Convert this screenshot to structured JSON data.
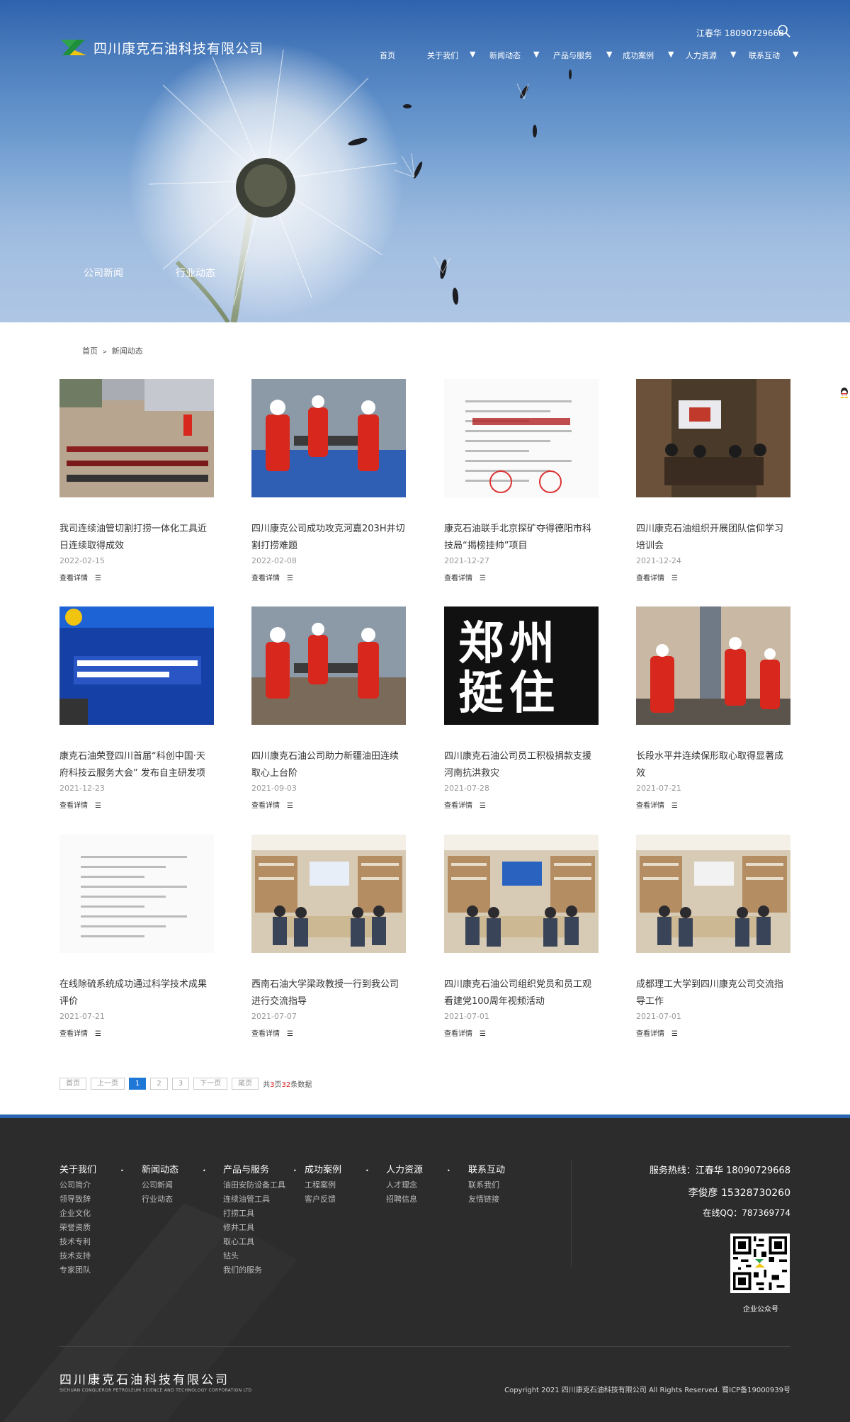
{
  "header": {
    "company_name": "四川康克石油科技有限公司",
    "contact": "江春华 18090729668",
    "nav": [
      "首页",
      "关于我们",
      "新闻动态",
      "产品与服务",
      "成功案例",
      "人力资源",
      "联系互动"
    ],
    "nav_has_dropdown": [
      false,
      true,
      true,
      true,
      true,
      true,
      true
    ]
  },
  "banner": {
    "subnav": [
      "公司新闻",
      "行业动态"
    ]
  },
  "breadcrumb": {
    "home": "首页",
    "separator": ">",
    "current": "新闻动态"
  },
  "news": {
    "more_label": "查看详情",
    "items": [
      {
        "title": "我司连续油管切割打捞一体化工具近日连续取得成效",
        "date": "2022-02-15",
        "img": "site"
      },
      {
        "title": "四川康克公司成功攻克河嘉203H井切割打捞难题",
        "date": "2022-02-08",
        "img": "workers"
      },
      {
        "title": "康克石油联手北京探矿夺得德阳市科技局“揭榜挂帅”项目",
        "date": "2021-12-27",
        "img": "doc-red"
      },
      {
        "title": "四川康克石油组织开展团队信仰学习培训会",
        "date": "2021-12-24",
        "img": "meeting"
      },
      {
        "title": "康克石油荣登四川首届“科创中国·天府科技云服务大会” 发布自主研发项",
        "date": "2021-12-23",
        "img": "screen"
      },
      {
        "title": "四川康克石油公司助力新疆油田连续取心上台阶",
        "date": "2021-09-03",
        "img": "workers2"
      },
      {
        "title": "四川康克石油公司员工积极捐款支援河南抗洪救灾",
        "date": "2021-07-28",
        "img": "zhengzhou"
      },
      {
        "title": "长段水平井连续保形取心取得显著成效",
        "date": "2021-07-21",
        "img": "rig"
      },
      {
        "title": "在线除硫系统成功通过科学技术成果评价",
        "date": "2021-07-21",
        "img": "doc"
      },
      {
        "title": "西南石油大学梁政教授一行到我公司进行交流指导",
        "date": "2021-07-07",
        "img": "conf"
      },
      {
        "title": "四川康克石油公司组织党员和员工观看建党100周年视频活动",
        "date": "2021-07-01",
        "img": "conf2"
      },
      {
        "title": "成都理工大学到四川康克公司交流指导工作",
        "date": "2021-07-01",
        "img": "conf3"
      }
    ],
    "zhengzhou_text": "郑州挺住"
  },
  "pagination": {
    "first": "首页",
    "prev": "上一页",
    "pages": [
      "1",
      "2",
      "3"
    ],
    "current": "1",
    "next": "下一页",
    "last": "尾页",
    "info_prefix": "共",
    "total_pages": "3",
    "info_mid": "页",
    "total_items": "32",
    "info_suffix": "条数据"
  },
  "footer": {
    "columns": [
      {
        "title": "关于我们",
        "links": [
          "公司简介",
          "领导致辞",
          "企业文化",
          "荣誉资质",
          "技术专利",
          "技术支持",
          "专家团队"
        ]
      },
      {
        "title": "新闻动态",
        "links": [
          "公司新闻",
          "行业动态"
        ]
      },
      {
        "title": "产品与服务",
        "links": [
          "油田安防设备工具",
          "连续油管工具",
          "打捞工具",
          "修井工具",
          "取心工具",
          "钻头",
          "我们的服务"
        ]
      },
      {
        "title": "成功案例",
        "links": [
          "工程案例",
          "客户反馈"
        ]
      },
      {
        "title": "人力资源",
        "links": [
          "人才理念",
          "招聘信息"
        ]
      },
      {
        "title": "联系互动",
        "links": [
          "联系我们",
          "友情链接"
        ]
      }
    ],
    "hotline": "服务热线：江春华 18090729668",
    "contact2": "李俊彦 15328730260",
    "qq": "在线QQ：787369774",
    "qr_caption": "企业公众号",
    "company_name": "四川康克石油科技有限公司",
    "company_name_en": "SICHUAN CONQUEROR PETROLEUM SCIENCE AND TECHNOLOGY CORPORATION LTD",
    "copyright": "Copyright 2021 四川康克石油科技有限公司 All Rights Reserved.  蜀ICP备19000939号"
  },
  "colors": {
    "accent": "#1f77d6",
    "footer_bg": "#2c2c2c",
    "footer_border": "#2a66b0",
    "banner_sky": "#4f86c5"
  }
}
